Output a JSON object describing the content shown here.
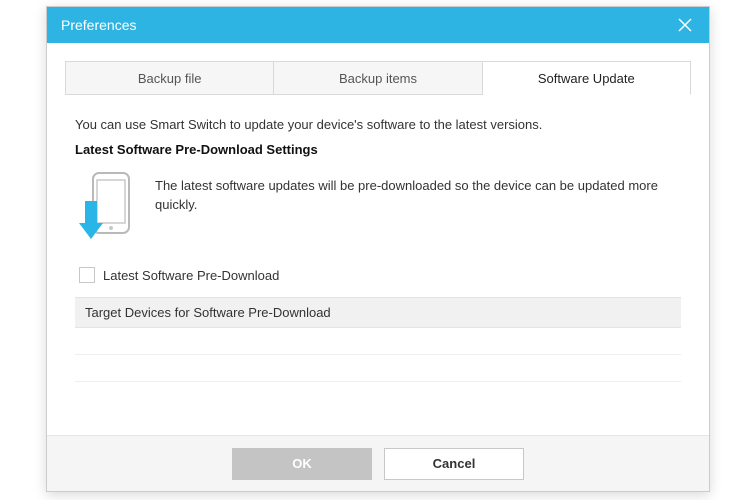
{
  "title": "Preferences",
  "tabs": [
    {
      "label": "Backup file",
      "active": false
    },
    {
      "label": "Backup items",
      "active": false
    },
    {
      "label": "Software Update",
      "active": true
    }
  ],
  "panel": {
    "intro": "You can use Smart Switch to update your device's software to the latest versions.",
    "section_title": "Latest Software Pre-Download Settings",
    "description": "The latest software updates will be pre-downloaded so the device can be updated more quickly.",
    "checkbox_label": "Latest Software Pre-Download",
    "checkbox_checked": false,
    "target_header": "Target Devices for Software Pre-Download"
  },
  "buttons": {
    "ok": "OK",
    "cancel": "Cancel"
  }
}
